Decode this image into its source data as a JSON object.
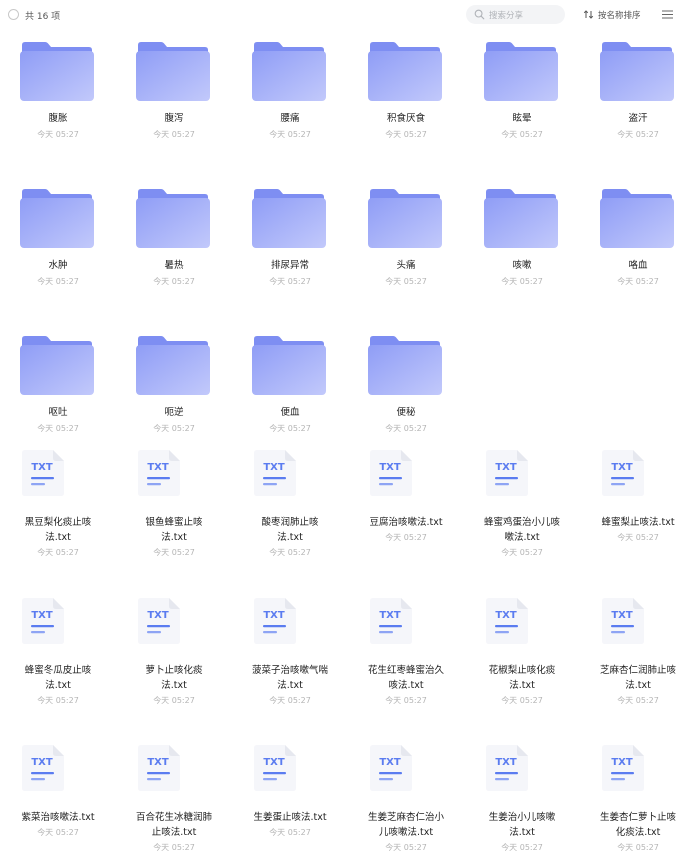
{
  "toolbar": {
    "count_label": "共 16 项",
    "search_placeholder": "搜索分享",
    "sort_label": "按名称排序"
  },
  "folders": [
    {
      "name": "腹胀",
      "date": "今天 05:27"
    },
    {
      "name": "腹泻",
      "date": "今天 05:27"
    },
    {
      "name": "腰痛",
      "date": "今天 05:27"
    },
    {
      "name": "积食厌食",
      "date": "今天 05:27"
    },
    {
      "name": "眩晕",
      "date": "今天 05:27"
    },
    {
      "name": "盗汗",
      "date": "今天 05:27"
    },
    {
      "name": "水肿",
      "date": "今天 05:27"
    },
    {
      "name": "暑热",
      "date": "今天 05:27"
    },
    {
      "name": "排尿异常",
      "date": "今天 05:27"
    },
    {
      "name": "头痛",
      "date": "今天 05:27"
    },
    {
      "name": "咳嗽",
      "date": "今天 05:27"
    },
    {
      "name": "咯血",
      "date": "今天 05:27"
    },
    {
      "name": "呕吐",
      "date": "今天 05:27"
    },
    {
      "name": "呃逆",
      "date": "今天 05:27"
    },
    {
      "name": "便血",
      "date": "今天 05:27"
    },
    {
      "name": "便秘",
      "date": "今天 05:27"
    }
  ],
  "files": [
    {
      "name_lines": [
        "黑豆梨化痰止咳",
        "法.txt"
      ],
      "date": "今天 05:27"
    },
    {
      "name_lines": [
        "银鱼蜂蜜止咳",
        "法.txt"
      ],
      "date": "今天 05:27"
    },
    {
      "name_lines": [
        "酸枣润肺止咳",
        "法.txt"
      ],
      "date": "今天 05:27"
    },
    {
      "name_lines": [
        "豆腐治咳嗽法.txt"
      ],
      "date": "今天 05:27"
    },
    {
      "name_lines": [
        "蜂蜜鸡蛋治小儿咳",
        "嗽法.txt"
      ],
      "date": "今天 05:27"
    },
    {
      "name_lines": [
        "蜂蜜梨止咳法.txt"
      ],
      "date": "今天 05:27"
    },
    {
      "name_lines": [
        "蜂蜜冬瓜皮止咳",
        "法.txt"
      ],
      "date": "今天 05:27"
    },
    {
      "name_lines": [
        "萝卜止咳化痰",
        "法.txt"
      ],
      "date": "今天 05:27"
    },
    {
      "name_lines": [
        "菠菜子治咳嗽气喘",
        "法.txt"
      ],
      "date": "今天 05:27"
    },
    {
      "name_lines": [
        "花生红枣蜂蜜治久",
        "咳法.txt"
      ],
      "date": "今天 05:27"
    },
    {
      "name_lines": [
        "花椒梨止咳化痰",
        "法.txt"
      ],
      "date": "今天 05:27"
    },
    {
      "name_lines": [
        "芝麻杏仁润肺止咳",
        "法.txt"
      ],
      "date": "今天 05:27"
    },
    {
      "name_lines": [
        "紫菜治咳嗽法.txt"
      ],
      "date": "今天 05:27"
    },
    {
      "name_lines": [
        "百合花生冰糖润肺",
        "止咳法.txt"
      ],
      "date": "今天 05:27"
    },
    {
      "name_lines": [
        "生姜蛋止咳法.txt"
      ],
      "date": "今天 05:27"
    },
    {
      "name_lines": [
        "生姜芝麻杏仁治小",
        "儿咳嗽法.txt"
      ],
      "date": "今天 05:27"
    },
    {
      "name_lines": [
        "生姜治小儿咳嗽",
        "法.txt"
      ],
      "date": "今天 05:27"
    },
    {
      "name_lines": [
        "生姜杏仁萝卜止咳",
        "化痰法.txt"
      ],
      "date": "今天 05:27"
    }
  ],
  "file_icon_label": "TXT",
  "colors": {
    "folder": "#9aa6f8",
    "txt_accent": "#5b7cf0"
  }
}
